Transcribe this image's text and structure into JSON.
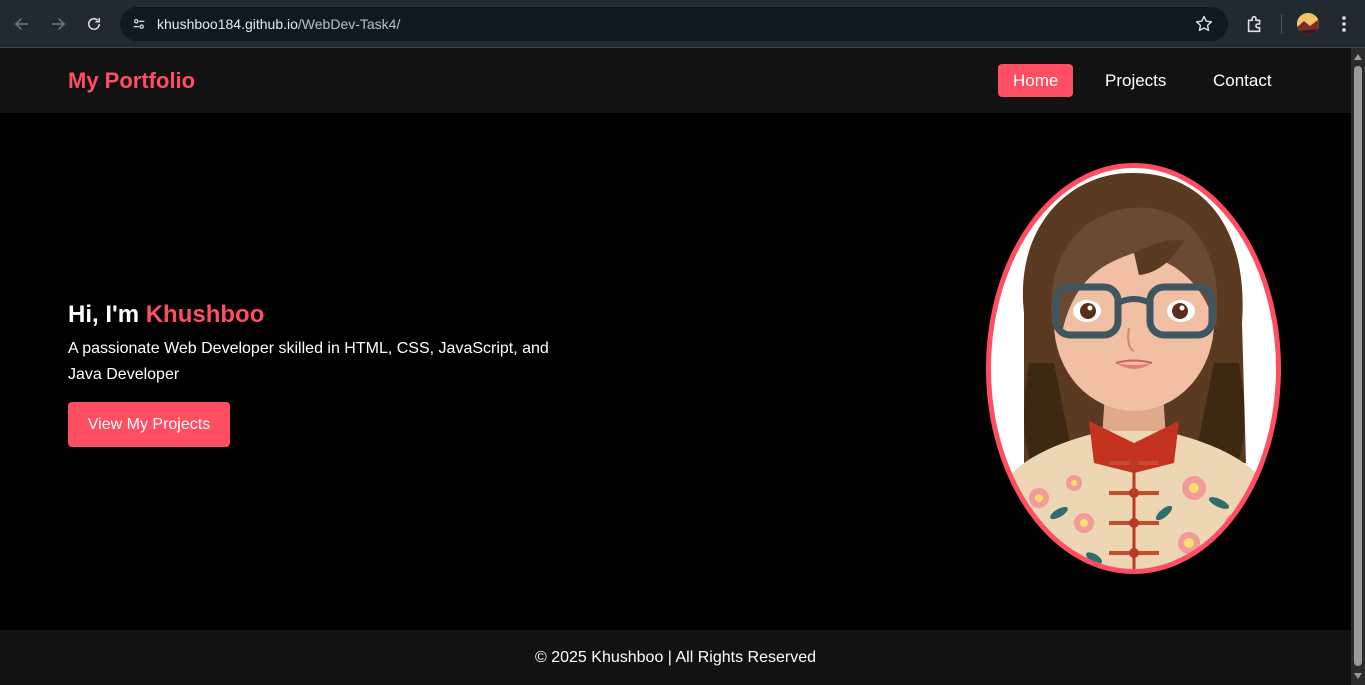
{
  "browser": {
    "url_host": "khushboo184.github.io",
    "url_path": "/WebDev-Task4/"
  },
  "site": {
    "brand": "My Portfolio",
    "nav": [
      "Home",
      "Projects",
      "Contact"
    ],
    "active_nav": "Home"
  },
  "hero": {
    "greeting_prefix": "Hi, I'm ",
    "name": "Khushboo",
    "description": "A passionate Web Developer skilled in HTML, CSS, JavaScript, and Java Developer",
    "cta_label": "View My Projects"
  },
  "footer": {
    "text": "© 2025 Khushboo | All Rights Reserved"
  },
  "colors": {
    "accent": "#ff4d62",
    "header_bg": "#121212",
    "page_bg": "#000000"
  }
}
